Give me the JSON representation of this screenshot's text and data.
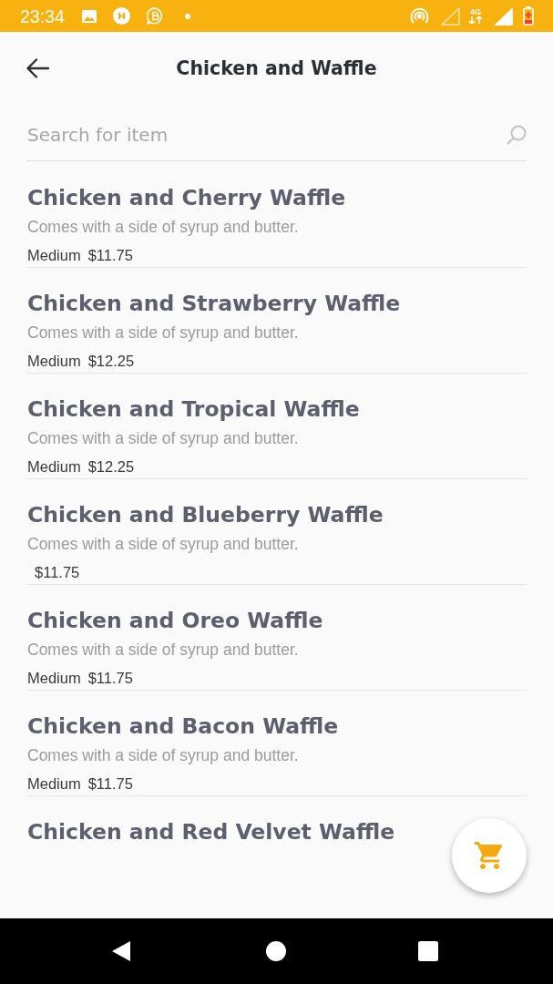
{
  "status_bar": {
    "time": "23:34",
    "network_type": "4G"
  },
  "header": {
    "title": "Chicken and Waffle"
  },
  "search": {
    "placeholder": "Search for item"
  },
  "menu_items": [
    {
      "name": "Chicken and Cherry Waffle",
      "description": "Comes with a side of syrup and butter.",
      "size": "Medium",
      "price": "$11.75"
    },
    {
      "name": "Chicken and Strawberry Waffle",
      "description": "Comes with a side of syrup and butter.",
      "size": "Medium",
      "price": "$12.25"
    },
    {
      "name": "Chicken and Tropical Waffle",
      "description": "Comes with a side of syrup and butter.",
      "size": "Medium",
      "price": "$12.25"
    },
    {
      "name": "Chicken and Blueberry Waffle",
      "description": "Comes with a side of syrup and butter.",
      "price": "$11.75"
    },
    {
      "name": "Chicken and Oreo Waffle",
      "description": "Comes with a side of syrup and butter.",
      "size": "Medium",
      "price": "$11.75"
    },
    {
      "name": "Chicken and Bacon Waffle",
      "description": "Comes with a side of syrup and butter.",
      "size": "Medium",
      "price": "$11.75"
    },
    {
      "name": "Chicken and Red Velvet Waffle"
    }
  ]
}
